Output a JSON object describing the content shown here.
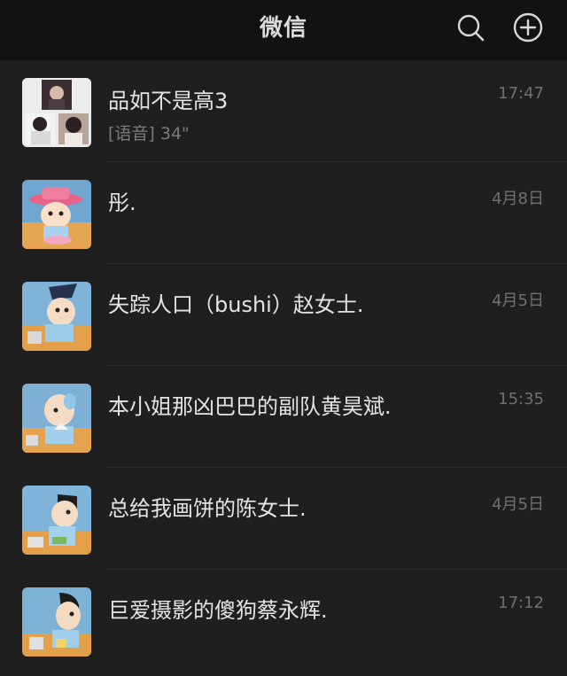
{
  "header": {
    "title": "微信",
    "search_icon": "search-icon",
    "add_icon": "plus-circle-icon"
  },
  "chats": [
    {
      "name": "品如不是高3",
      "preview": "[语音] 34\"",
      "time": "17:47"
    },
    {
      "name": "彤.",
      "preview": "",
      "time": "4月8日"
    },
    {
      "name": "失踪人口（bushi）赵女士.",
      "preview": "",
      "time": "4月5日"
    },
    {
      "name": "本小姐那凶巴巴的副队黄昊斌.",
      "preview": "",
      "time": "15:35"
    },
    {
      "name": "总给我画饼的陈女士.",
      "preview": "",
      "time": "4月5日"
    },
    {
      "name": "巨爱摄影的傻狗蔡永辉.",
      "preview": "",
      "time": "17:12"
    }
  ],
  "colors": {
    "header_bg": "#121212",
    "list_bg": "#1f1f1f",
    "name_text": "#e4e4e4",
    "meta_text": "#6f6f6f"
  }
}
